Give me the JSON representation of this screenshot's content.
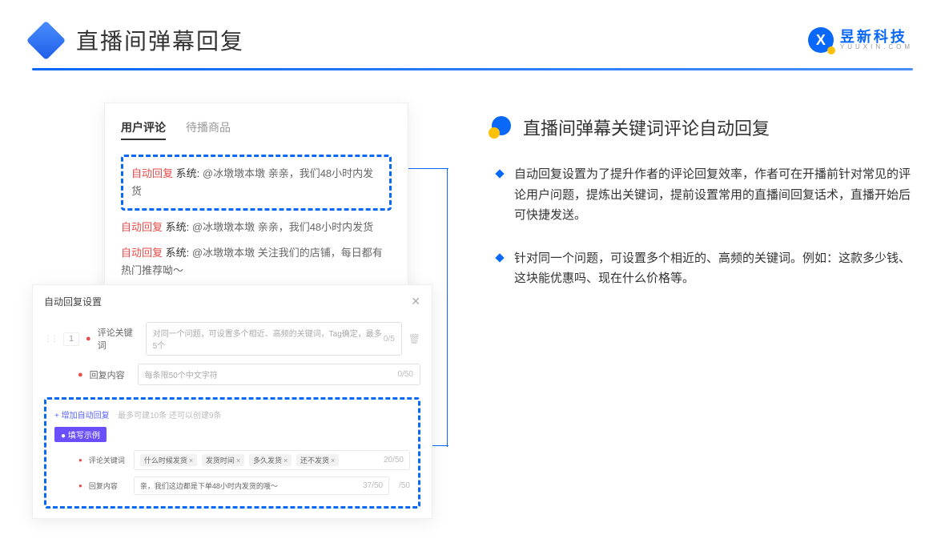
{
  "header": {
    "title": "直播间弹幕回复",
    "logo_main": "昱新科技",
    "logo_sub": "YUUXIN.COM",
    "logo_x": "X"
  },
  "chat": {
    "tab_active": "用户评论",
    "tab_inactive": "待播商品",
    "reply_tag": "自动回复",
    "sys": "系统:",
    "msg1": "@冰墩墩本墩 亲亲，我们48小时内发货",
    "msg2": "@冰墩墩本墩 亲亲，我们48小时内发货",
    "msg3": "@冰墩墩本墩 关注我们的店铺，每日都有热门推荐呦～"
  },
  "settings": {
    "title": "自动回复设置",
    "row_num": "1",
    "label_keyword": "评论关键词",
    "placeholder_keyword": "对同一个问题，可设置多个相近、高频的关键词，Tag确定，最多5个",
    "counter_keyword": "0/5",
    "label_content": "回复内容",
    "placeholder_content": "每条限50个中文字符",
    "counter_content": "0/50",
    "add_link": "+ 增加自动回复",
    "add_hint": "最多可建10条 还可以创建9条",
    "example_badge": "● 填写示例",
    "example_label_kw": "评论关键词",
    "tags": [
      "什么时候发货",
      "发货时间",
      "多久发货",
      "还不发货"
    ],
    "ex_counter1": "20/50",
    "example_label_ct": "回复内容",
    "example_content": "亲，我们这边都是下单48小时内发货的哦～",
    "ex_counter2": "37/50",
    "ex_counter3": "/50"
  },
  "right": {
    "section_title": "直播间弹幕关键词评论自动回复",
    "bullet1": "自动回复设置为了提升作者的评论回复效率，作者可在开播前针对常见的评论用户问题，提炼出关键词，提前设置常用的直播间回复话术，直播开始后可快捷发送。",
    "bullet2": "针对同一个问题，可设置多个相近的、高频的关键词。例如：这款多少钱、这块能优惠吗、现在什么价格等。"
  }
}
